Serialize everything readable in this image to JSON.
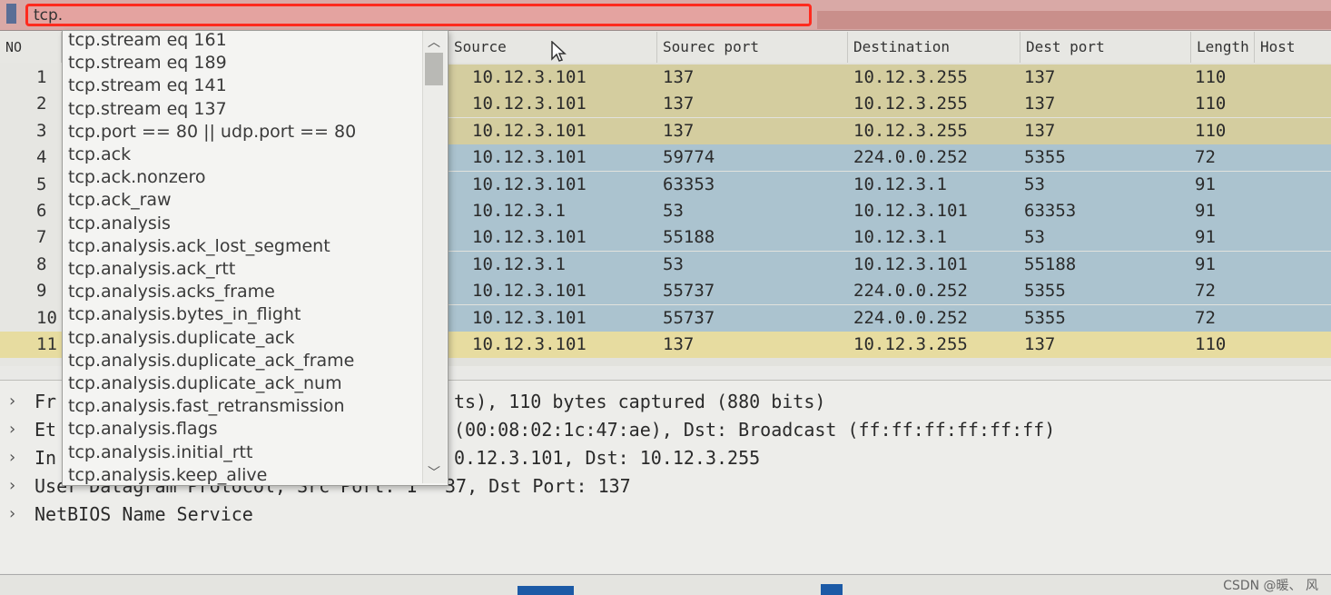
{
  "filter": {
    "value": "tcp."
  },
  "columns": {
    "no": "NO",
    "source": "Source",
    "source_port": "Sourec port",
    "destination": "Destination",
    "dest_port": "Dest port",
    "length": "Length",
    "host": "Host"
  },
  "colors": {
    "filter_highlight": "#ff2a1e",
    "row_yellow": "#d4cd9f",
    "row_blue": "#abc3cf"
  },
  "packets": [
    {
      "no": "1",
      "source": "10.12.3.101",
      "sport": "137",
      "dest": "10.12.3.255",
      "dport": "137",
      "length": "110",
      "color": "yellow"
    },
    {
      "no": "2",
      "source": "10.12.3.101",
      "sport": "137",
      "dest": "10.12.3.255",
      "dport": "137",
      "length": "110",
      "color": "yellow"
    },
    {
      "no": "3",
      "source": "10.12.3.101",
      "sport": "137",
      "dest": "10.12.3.255",
      "dport": "137",
      "length": "110",
      "color": "yellow"
    },
    {
      "no": "4",
      "source": "10.12.3.101",
      "sport": "59774",
      "dest": "224.0.0.252",
      "dport": "5355",
      "length": "72",
      "color": "blue"
    },
    {
      "no": "5",
      "source": "10.12.3.101",
      "sport": "63353",
      "dest": "10.12.3.1",
      "dport": "53",
      "length": "91",
      "color": "blue"
    },
    {
      "no": "6",
      "source": "10.12.3.1",
      "sport": "53",
      "dest": "10.12.3.101",
      "dport": "63353",
      "length": "91",
      "color": "blue"
    },
    {
      "no": "7",
      "source": "10.12.3.101",
      "sport": "55188",
      "dest": "10.12.3.1",
      "dport": "53",
      "length": "91",
      "color": "blue"
    },
    {
      "no": "8",
      "source": "10.12.3.1",
      "sport": "53",
      "dest": "10.12.3.101",
      "dport": "55188",
      "length": "91",
      "color": "blue"
    },
    {
      "no": "9",
      "source": "10.12.3.101",
      "sport": "55737",
      "dest": "224.0.0.252",
      "dport": "5355",
      "length": "72",
      "color": "blue"
    },
    {
      "no": "10",
      "source": "10.12.3.101",
      "sport": "55737",
      "dest": "224.0.0.252",
      "dport": "5355",
      "length": "72",
      "color": "blue"
    },
    {
      "no": "11",
      "source": "10.12.3.101",
      "sport": "137",
      "dest": "10.12.3.255",
      "dport": "137",
      "length": "110",
      "color": "selected"
    }
  ],
  "autocomplete": [
    "tcp.stream eq 161",
    "tcp.stream eq 189",
    "tcp.stream eq 141",
    "tcp.stream eq 137",
    "tcp.port == 80 || udp.port == 80",
    "tcp.ack",
    "tcp.ack.nonzero",
    "tcp.ack_raw",
    "tcp.analysis",
    "tcp.analysis.ack_lost_segment",
    "tcp.analysis.ack_rtt",
    "tcp.analysis.acks_frame",
    "tcp.analysis.bytes_in_flight",
    "tcp.analysis.duplicate_ack",
    "tcp.analysis.duplicate_ack_frame",
    "tcp.analysis.duplicate_ack_num",
    "tcp.analysis.fast_retransmission",
    "tcp.analysis.flags",
    "tcp.analysis.initial_rtt",
    "tcp.analysis.keep_alive"
  ],
  "details": [
    {
      "prefix": "Fr",
      "text": "ts), 110 bytes captured (880 bits)"
    },
    {
      "prefix": "Et",
      "text": "(00:08:02:1c:47:ae), Dst: Broadcast (ff:ff:ff:ff:ff:ff)"
    },
    {
      "prefix": "In",
      "text": "0.12.3.101, Dst: 10.12.3.255"
    },
    {
      "prefix": "User Datagram Protocol, Src Port: 1",
      "text": "37, Dst Port: 137"
    },
    {
      "prefix": "NetBIOS Name Service",
      "text": ""
    }
  ],
  "watermark": "CSDN @暖、 风"
}
